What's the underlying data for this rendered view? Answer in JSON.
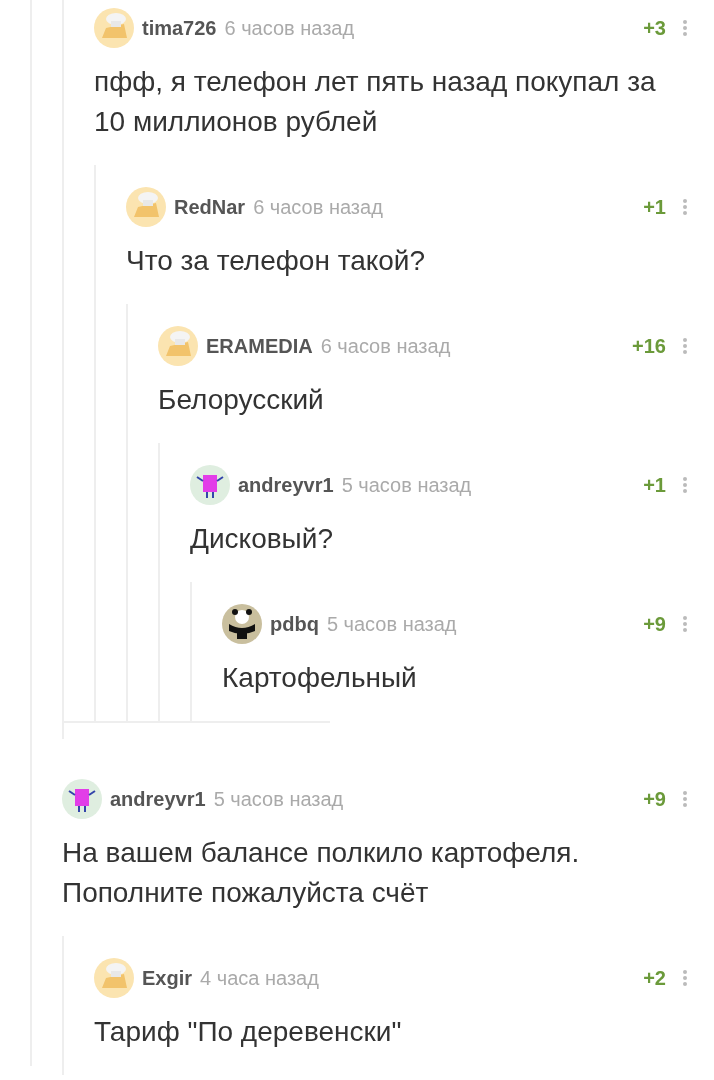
{
  "reply_branch": [
    {
      "author": "tima726",
      "time": "6 часов назад",
      "score": "+3",
      "kind": "cheese",
      "text": "пфф, я телефон лет пять назад покупал за 10 миллионов рублей",
      "children": [
        {
          "author": "RedNar",
          "time": "6 часов назад",
          "score": "+1",
          "kind": "cheese",
          "text": "Что за телефон такой?",
          "children": [
            {
              "author": "ERAMEDIA",
              "time": "6 часов назад",
              "score": "+16",
              "kind": "cheese",
              "text": "Белорусский",
              "children": [
                {
                  "author": "andreyvr1",
                  "time": "5 часов назад",
                  "score": "+1",
                  "kind": "monster",
                  "text": "Дисковый?",
                  "children": [
                    {
                      "author": "pdbq",
                      "time": "5 часов назад",
                      "score": "+9",
                      "kind": "bear",
                      "text": "Картофельный"
                    }
                  ]
                }
              ]
            }
          ]
        }
      ]
    }
  ],
  "comments": [
    {
      "author": "andreyvr1",
      "time": "5 часов назад",
      "score": "+9",
      "kind": "monster",
      "text": "На вашем балансе полкило картофеля. Пополните пожалуйста счёт",
      "children": [
        {
          "author": "Exgir",
          "time": "4 часа назад",
          "score": "+2",
          "kind": "cheese",
          "text": "Тариф \"По деревенски\""
        }
      ]
    }
  ]
}
